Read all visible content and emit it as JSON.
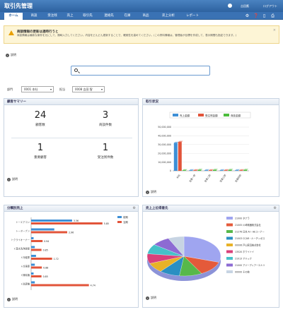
{
  "app": {
    "title": "取引先管理",
    "user": "吉田鷹",
    "logout": "ログアウト"
  },
  "nav": {
    "tabs": [
      "ホーム",
      "商談",
      "受注残",
      "売上",
      "取引先",
      "連絡先",
      "在庫",
      "商品",
      "売上分析",
      "レポート"
    ],
    "icons": [
      "gear-icon",
      "help-icon",
      "mobile-icon",
      "print-icon"
    ]
  },
  "notice": {
    "title": "商談情報の更新は週時行うと",
    "body": "商談情報は最新な案件を元にして、随時入力してください。内容をどんどん更新することで、確実性を高めてください。(この資料情報は、管理者が目標を作成して、表示期間も指定できます。)"
  },
  "help_label": "説明",
  "search": {
    "placeholder": ""
  },
  "filters": {
    "dept_label": "部門",
    "dept_value": "0001 本社",
    "owner_label": "担当",
    "owner_value": "0008 吉田 智"
  },
  "summary": {
    "title": "顧客サマリー",
    "kpis": [
      {
        "value": "24",
        "label": "顧客数"
      },
      {
        "value": "3",
        "label": "商談件数"
      },
      {
        "value": "1",
        "label": "重要顧客"
      },
      {
        "value": "1",
        "label": "受注残件数"
      }
    ]
  },
  "chart_data": [
    {
      "type": "bar",
      "title": "取引状況",
      "legend": [
        "売上金額",
        "受注残金額",
        "商談金額"
      ],
      "legend_placement": "top",
      "categories": [
        "本社",
        "営業一部",
        "営業二部",
        "営業三部",
        "営業四部"
      ],
      "series": [
        {
          "name": "売上金額",
          "values": [
            32000000,
            0,
            0,
            0,
            0
          ]
        },
        {
          "name": "受注残金額",
          "values": [
            33000000,
            0,
            0,
            0,
            0
          ]
        },
        {
          "name": "商談金額",
          "values": [
            0,
            1000000,
            1000000,
            1000000,
            1000000
          ]
        }
      ],
      "ylim": [
        0,
        50000000
      ],
      "yticks": [
        "50,000,000",
        "40,000,000",
        "30,000,000",
        "20,000,000",
        "10,000,000",
        "0"
      ],
      "colors": [
        "#3d8fd6",
        "#e2543a",
        "#4cbc3c"
      ]
    },
    {
      "type": "bar",
      "orientation": "horizontal",
      "title": "分類別売上",
      "legend": [
        "前期",
        "当期"
      ],
      "categories": [
        "トーエアコン",
        "トーオーブン",
        "トクライオーナー",
        "ト温水洗浄便座",
        "ト冷蔵庫",
        "ト冷凍庫",
        "ト掃除機",
        "ト洗濯機"
      ],
      "series": [
        {
          "name": "前期",
          "values": [
            3.36,
            1.9,
            0.2,
            0.3,
            0.4,
            0.3,
            0.2,
            0.3
          ]
        },
        {
          "name": "当期",
          "values": [
            5.85,
            2.96,
            0.94,
            0.85,
            1.72,
            0.88,
            0.85,
            4.74
          ]
        }
      ],
      "data_labels": [
        "3.36",
        "5.85",
        "2.96",
        "0.94",
        "0.85",
        "1.72",
        "0.88",
        "0.85",
        "4.74"
      ],
      "colors": [
        "#3d8fd6",
        "#e2543a"
      ]
    },
    {
      "type": "pie",
      "title": "売上上位得意先",
      "slices": [
        {
          "label": "21000 タナラ",
          "value": 30,
          "color": "#9fa5f0"
        },
        {
          "label": "21005 川崎電器株式会社",
          "value": 12,
          "color": "#e45a3a"
        },
        {
          "label": "21276 日本 AI・AEコーナー",
          "value": 10,
          "color": "#57b84a"
        },
        {
          "label": "21003 CCAR・ルーチンボス",
          "value": 9,
          "color": "#2a8fc2"
        },
        {
          "label": "00006 戸山家具株式会社",
          "value": 8,
          "color": "#e8b227"
        },
        {
          "label": "13520 ホワイトイ",
          "value": 8,
          "color": "#d9407a"
        },
        {
          "label": "21013 アルック",
          "value": 8,
          "color": "#46c1c9"
        },
        {
          "label": "21000 アジーディアーエルリ",
          "value": 8,
          "color": "#8d6bd3"
        },
        {
          "label": "00000 その他",
          "value": 7,
          "color": "#c7d4e3"
        }
      ]
    }
  ]
}
